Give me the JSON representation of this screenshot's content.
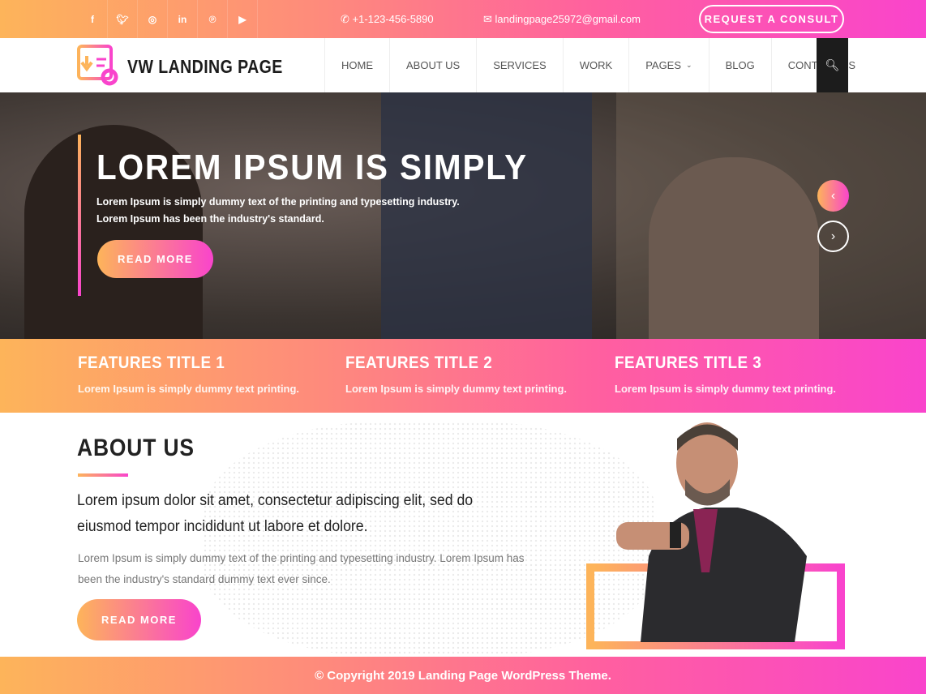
{
  "topbar": {
    "social": [
      "f",
      "t",
      "ig",
      "in",
      "p",
      "yt"
    ],
    "phone": "+1-123-456-5890",
    "email": "landingpage25972@gmail.com",
    "consult": "REQUEST A CONSULT"
  },
  "nav": {
    "logo": "VW LANDING PAGE",
    "items": [
      "HOME",
      "ABOUT US",
      "SERVICES",
      "WORK",
      "PAGES",
      "BLOG",
      "CONTACT US"
    ]
  },
  "hero": {
    "title": "LOREM IPSUM IS SIMPLY",
    "line1": "Lorem Ipsum is simply dummy text of the printing and typesetting industry.",
    "line2": "Lorem Ipsum has been the industry's standard.",
    "button": "READ MORE"
  },
  "features": [
    {
      "title": "FEATURES TITLE 1",
      "text": "Lorem Ipsum is simply dummy text printing."
    },
    {
      "title": "FEATURES TITLE 2",
      "text": "Lorem Ipsum is simply dummy text printing."
    },
    {
      "title": "FEATURES TITLE 3",
      "text": "Lorem Ipsum is simply dummy text printing."
    }
  ],
  "about": {
    "heading": "ABOUT US",
    "lead": "Lorem ipsum dolor sit amet, consectetur adipiscing elit, sed do eiusmod tempor incididunt ut labore et dolore.",
    "text": "Lorem Ipsum is simply dummy text of the printing and typesetting industry. Lorem Ipsum has been the industry's standard dummy text ever since.",
    "button": "READ MORE"
  },
  "footer": {
    "copyright": "© Copyright 2019 Landing Page WordPress Theme."
  },
  "colors": {
    "gradient_start": "#fdb45a",
    "gradient_end": "#f944cc"
  }
}
